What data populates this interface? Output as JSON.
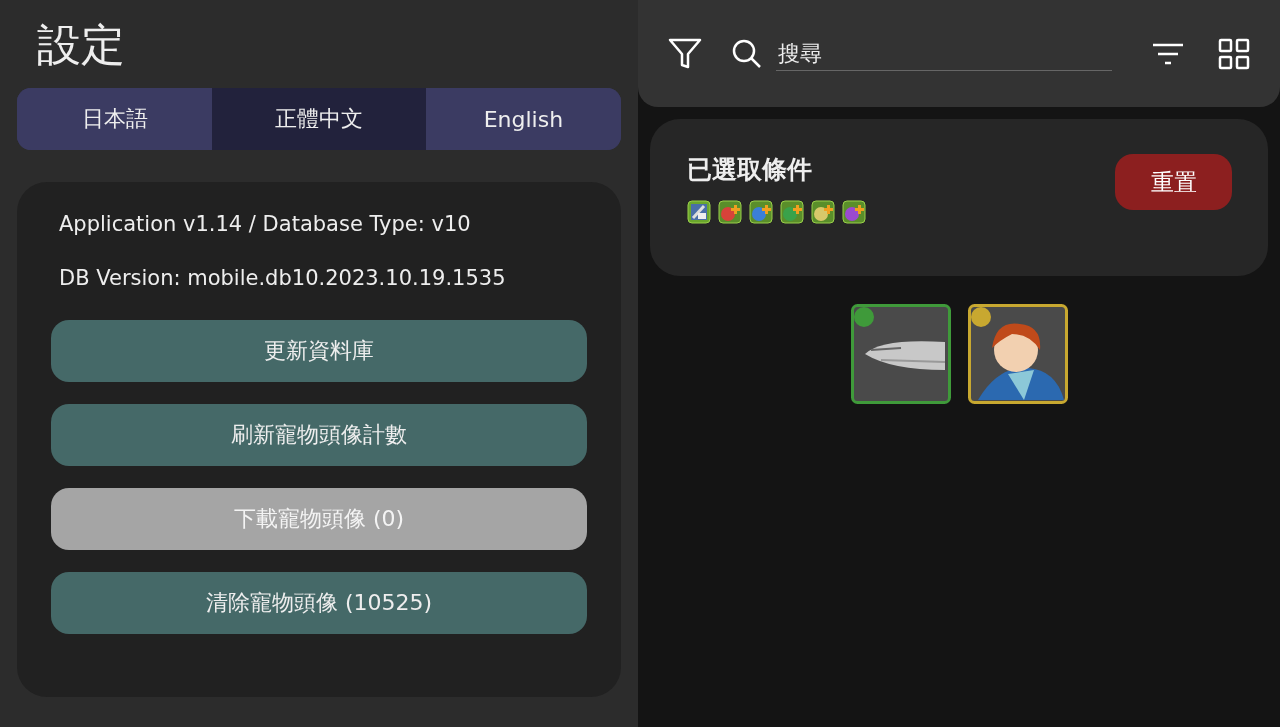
{
  "settings": {
    "title": "設定",
    "language_tabs": [
      {
        "label": "日本語",
        "selected": false
      },
      {
        "label": "正體中文",
        "selected": true
      },
      {
        "label": "English",
        "selected": false
      }
    ],
    "info": [
      "Application v1.14 / Database Type: v10",
      "DB Version: mobile.db10.2023.10.19.1535"
    ],
    "buttons": [
      {
        "label": "更新資料庫",
        "disabled": false
      },
      {
        "label": "刷新寵物頭像計數",
        "disabled": false
      },
      {
        "label": "下載寵物頭像 (0)",
        "disabled": true
      },
      {
        "label": "清除寵物頭像 (10525)",
        "disabled": false
      }
    ]
  },
  "search": {
    "placeholder": "搜尋"
  },
  "conditions": {
    "title": "已選取條件",
    "reset_button": "重置",
    "chips": [
      {
        "kind": "equip",
        "color": "#4a6fa8"
      },
      {
        "kind": "orb",
        "color": "#d8433a"
      },
      {
        "kind": "orb",
        "color": "#3b7fd8"
      },
      {
        "kind": "orb",
        "color": "#3aa24a"
      },
      {
        "kind": "orb",
        "color": "#d8c86a"
      },
      {
        "kind": "orb",
        "color": "#9a4ad0"
      }
    ]
  },
  "results": [
    {
      "kind": "ship",
      "color": "#3f9a3a"
    },
    {
      "kind": "pilot",
      "color": "#c8a830"
    }
  ]
}
